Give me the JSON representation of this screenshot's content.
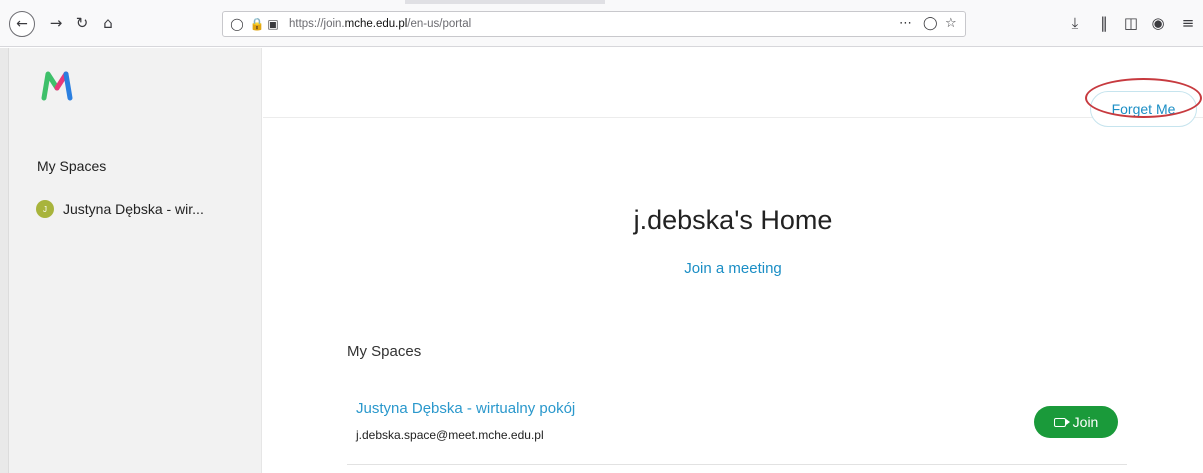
{
  "browser": {
    "url_prefix": "https://join.",
    "url_domain": "mche.edu.pl",
    "url_path": "/en-us/portal",
    "icons": [
      "back-arrow-icon",
      "forward-arrow-icon",
      "reload-icon",
      "home-icon",
      "shield-icon",
      "lock-icon",
      "permissions-icon",
      "more-icon",
      "pocket-icon",
      "star-icon",
      "download-icon",
      "library-icon",
      "sidebar-toggle-icon",
      "account-icon",
      "menu-icon"
    ]
  },
  "sidebar": {
    "title": "My Spaces",
    "items": [
      {
        "avatar_letter": "J",
        "label": "Justyna Dębska - wir..."
      }
    ]
  },
  "header": {
    "forget_label": "Forget Me"
  },
  "main": {
    "home_title": "j.debska's Home",
    "join_meeting_label": "Join a meeting",
    "section_title": "My Spaces",
    "spaces": [
      {
        "name": "Justyna Dębska - wirtualny pokój",
        "address": "j.debska.space@meet.mche.edu.pl",
        "join_label": "Join"
      }
    ]
  },
  "colors": {
    "accent": "#1b8ec5",
    "join_green": "#1a9a3a",
    "annotation_red": "#c73a3f",
    "avatar": "#a8b43c"
  }
}
